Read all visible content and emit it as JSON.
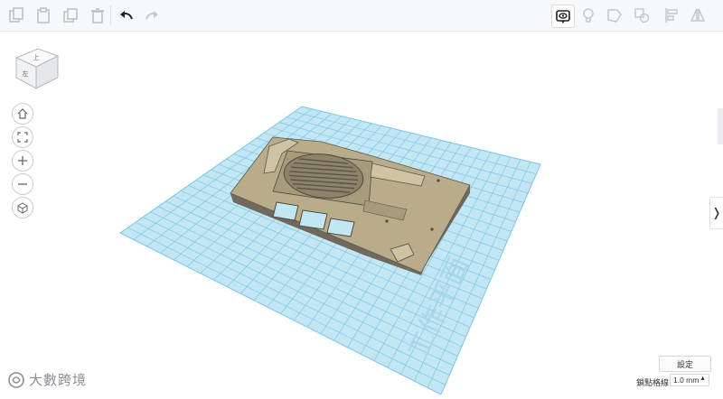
{
  "toolbar": {
    "tools": [
      {
        "name": "copy-icon",
        "enabled": false
      },
      {
        "name": "paste-icon",
        "enabled": false
      },
      {
        "name": "duplicate-icon",
        "enabled": false
      },
      {
        "name": "delete-icon",
        "enabled": false
      },
      {
        "name": "undo-icon",
        "enabled": true
      },
      {
        "name": "redo-icon",
        "enabled": false
      }
    ],
    "right_tools": [
      {
        "name": "show-all-icon",
        "enabled": true
      },
      {
        "name": "light-bulb-icon",
        "enabled": false
      },
      {
        "name": "group-icon",
        "enabled": false
      },
      {
        "name": "ungroup-icon",
        "enabled": false
      },
      {
        "name": "align-icon",
        "enabled": false
      },
      {
        "name": "mirror-icon",
        "enabled": false
      }
    ]
  },
  "viewcube": {
    "front_label": "左",
    "top_label": "上"
  },
  "nav": [
    "home-icon",
    "fit-view-icon",
    "zoom-in-icon",
    "zoom-out-icon",
    "perspective-icon"
  ],
  "bottom": {
    "settings_label": "設定",
    "snap_label": "鎖點格線",
    "snap_value": "1.0 mm"
  },
  "watermark": {
    "text": "大數跨境",
    "plane_text": "工作平面"
  },
  "colors": {
    "grid_fill": "#bfe4f3",
    "grid_line": "#7fc7e3",
    "model_top": "#b8ac8a",
    "model_side": "#6f6a5c",
    "accent": "#2a2a2a"
  }
}
